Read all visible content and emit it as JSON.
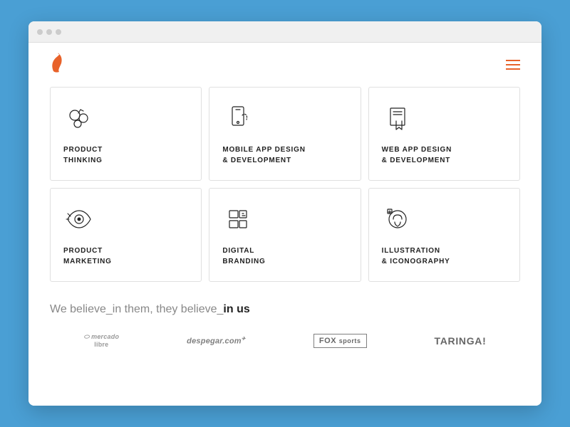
{
  "browser": {
    "dots": [
      "dot1",
      "dot2",
      "dot3"
    ]
  },
  "navbar": {
    "logo_symbol": "🔥",
    "menu_label": "≡"
  },
  "services": [
    {
      "id": "product-thinking",
      "label": "PRODUCT\nTHINKING",
      "icon": "circles-icon"
    },
    {
      "id": "mobile-app",
      "label": "MOBILE APP DESIGN\n& DEVELOPMENT",
      "icon": "phone-icon"
    },
    {
      "id": "web-app",
      "label": "WEB APP DESIGN\n& DEVELOPMENT",
      "icon": "hand-icon"
    },
    {
      "id": "product-marketing",
      "label": "PRODUCT\nMARKETING",
      "icon": "eye-icon"
    },
    {
      "id": "digital-branding",
      "label": "DIGITAL\nBRANDING",
      "icon": "branding-icon"
    },
    {
      "id": "illustration",
      "label": "ILLUSTRATION\n& ICONOGRAPHY",
      "icon": "illustration-icon"
    }
  ],
  "tagline": {
    "prefix": "We believe_in them, they believe_",
    "emphasis": "in us"
  },
  "clients": [
    {
      "id": "mercado-libre",
      "name": "mercado\nlibre",
      "style": "mercado"
    },
    {
      "id": "despegar",
      "name": "despegar.com",
      "style": "despegar"
    },
    {
      "id": "fox",
      "name": "FOX sports",
      "style": "fox"
    },
    {
      "id": "taringa",
      "name": "TARINGA!",
      "style": "taringa"
    }
  ]
}
